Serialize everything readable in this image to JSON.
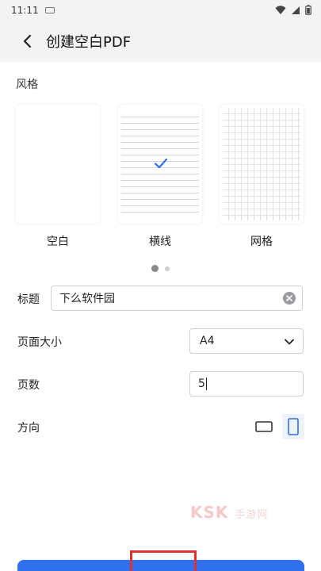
{
  "status_bar": {
    "time": "11:11"
  },
  "header": {
    "title": "创建空白PDF"
  },
  "style_section": {
    "label": "风格",
    "options": [
      {
        "label": "空白",
        "selected": false
      },
      {
        "label": "横线",
        "selected": true
      },
      {
        "label": "网格",
        "selected": false
      }
    ],
    "page_indicator": {
      "current": 1,
      "total": 2
    }
  },
  "form": {
    "title": {
      "label": "标题",
      "value": "下么软件园"
    },
    "page_size": {
      "label": "页面大小",
      "value": "A4"
    },
    "page_count": {
      "label": "页数",
      "value": "5"
    },
    "orientation": {
      "label": "方向",
      "selected": "portrait"
    }
  },
  "watermark": {
    "brand": "KSK",
    "sub": "手游网"
  },
  "colors": {
    "accent": "#2f6ff0",
    "highlight_box": "#e03030"
  }
}
